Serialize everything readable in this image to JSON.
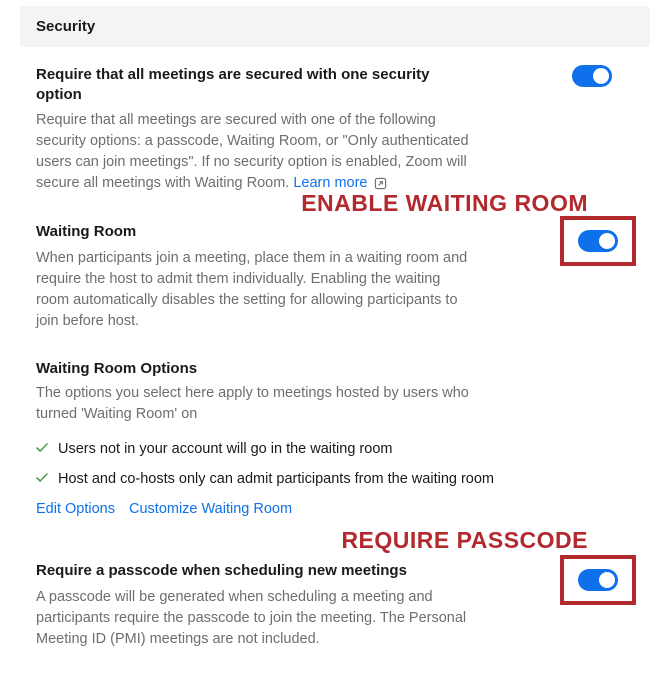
{
  "section": {
    "title": "Security"
  },
  "annotations": {
    "waiting_room": "ENABLE WAITING ROOM",
    "passcode": "REQUIRE PASSCODE"
  },
  "colors": {
    "accent_red": "#b2292e",
    "accent_blue": "#0e71eb",
    "text_muted": "#6e6e6e"
  },
  "settings": {
    "require_security": {
      "title": "Require that all meetings are secured with one security option",
      "desc_before": "Require that all meetings are secured with one of the following security options: a passcode, Waiting Room, or \"Only authenticated users can join meetings\". If no security option is enabled, Zoom will secure all meetings with Waiting Room. ",
      "learn_more": "Learn more",
      "toggle_on": true
    },
    "waiting_room": {
      "title": "Waiting Room",
      "desc": "When participants join a meeting, place them in a waiting room and require the host to admit them individually. Enabling the waiting room automatically disables the setting for allowing participants to join before host.",
      "toggle_on": true
    },
    "waiting_room_options": {
      "title": "Waiting Room Options",
      "desc": "The options you select here apply to meetings hosted by users who turned 'Waiting Room' on",
      "items": [
        "Users not in your account will go in the waiting room",
        "Host and co-hosts only can admit participants from the waiting room"
      ],
      "edit_link": "Edit Options",
      "customize_link": "Customize Waiting Room"
    },
    "passcode": {
      "title": "Require a passcode when scheduling new meetings",
      "desc": "A passcode will be generated when scheduling a meeting and participants require the passcode to join the meeting. The Personal Meeting ID (PMI) meetings are not included.",
      "toggle_on": true
    }
  }
}
